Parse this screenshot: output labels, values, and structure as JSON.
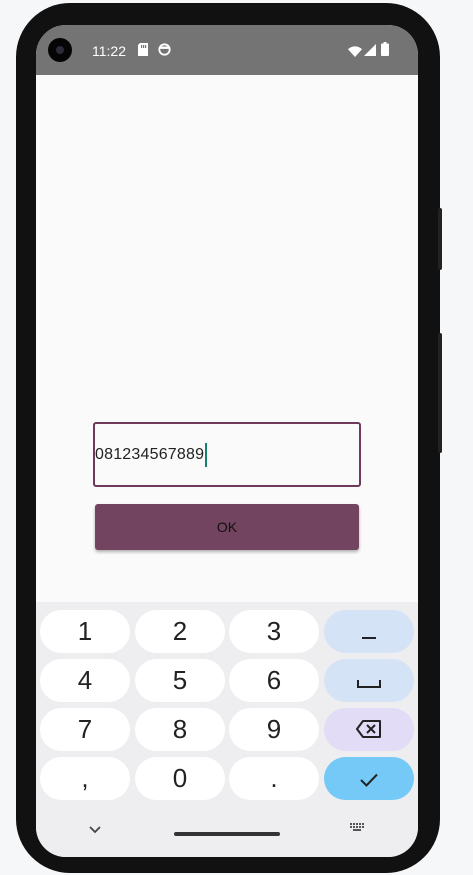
{
  "status_bar": {
    "time": "11:22",
    "left_icons": [
      "sd-card-icon",
      "face-status-icon"
    ],
    "right_icons": [
      "wifi-icon",
      "cell-signal-icon",
      "battery-icon"
    ]
  },
  "form": {
    "phone_value": "081234567889",
    "ok_label": "OK"
  },
  "colors": {
    "accent": "#72445f",
    "input_border": "#6d3a5a",
    "caret": "#16806f",
    "enter_key": "#74c9f6"
  },
  "keyboard": {
    "keys": [
      {
        "label": "1"
      },
      {
        "label": "2"
      },
      {
        "label": "3"
      },
      {
        "label": "−",
        "icon": "minus-icon"
      },
      {
        "label": "4"
      },
      {
        "label": "5"
      },
      {
        "label": "6"
      },
      {
        "label": "",
        "icon": "space-icon"
      },
      {
        "label": "7"
      },
      {
        "label": "8"
      },
      {
        "label": "9"
      },
      {
        "label": "",
        "icon": "backspace-icon"
      },
      {
        "label": ","
      },
      {
        "label": "0"
      },
      {
        "label": "."
      },
      {
        "label": "",
        "icon": "check-icon"
      }
    ]
  },
  "nav_bar": {
    "icons": [
      "chevron-down-icon",
      "home-handle",
      "keyboard-switch-icon"
    ]
  }
}
